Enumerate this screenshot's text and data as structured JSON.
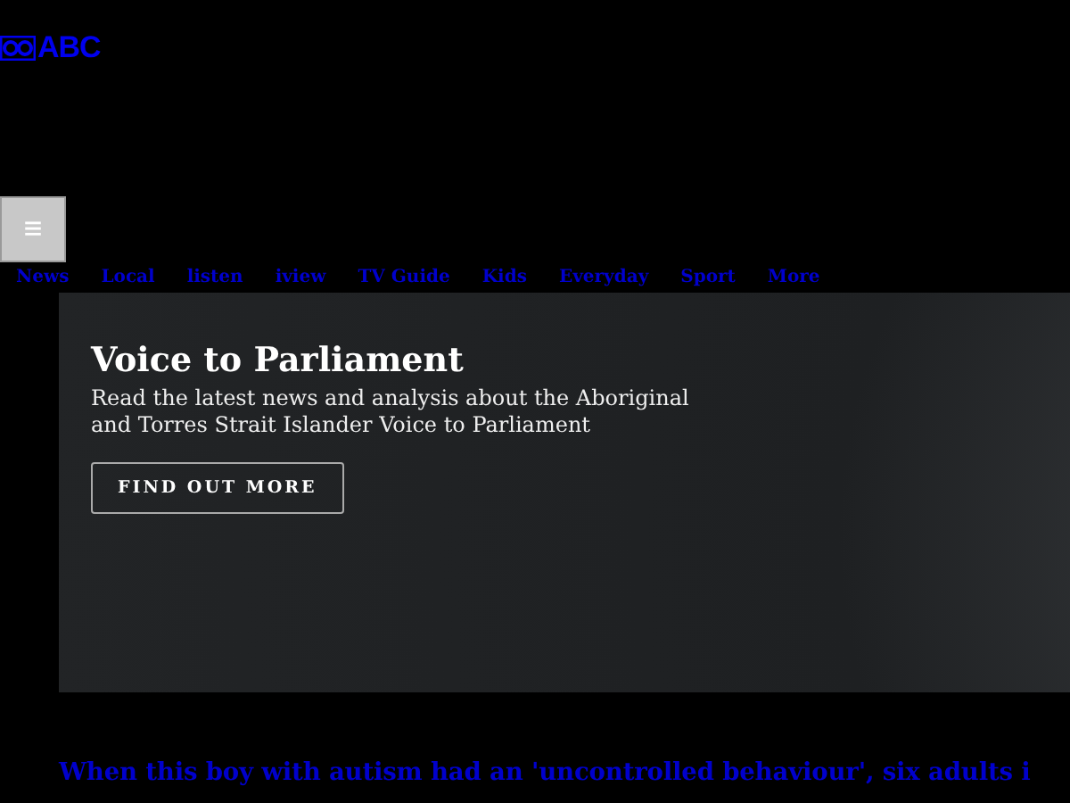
{
  "logo": {
    "text": "ABC"
  },
  "menu_button": {
    "label": "≡"
  },
  "nav": [
    "News",
    "Local",
    "listen",
    "iview",
    "TV Guide",
    "Kids",
    "Everyday",
    "Sport",
    "More"
  ],
  "hero": {
    "title": "Voice to Parliament",
    "description": "Read the latest news and analysis about the Aboriginal and Torres Strait Islander Voice to Parliament",
    "button": "FIND OUT MORE"
  },
  "headline": "When this boy with autism had an 'uncontrolled behaviour', six adults i"
}
